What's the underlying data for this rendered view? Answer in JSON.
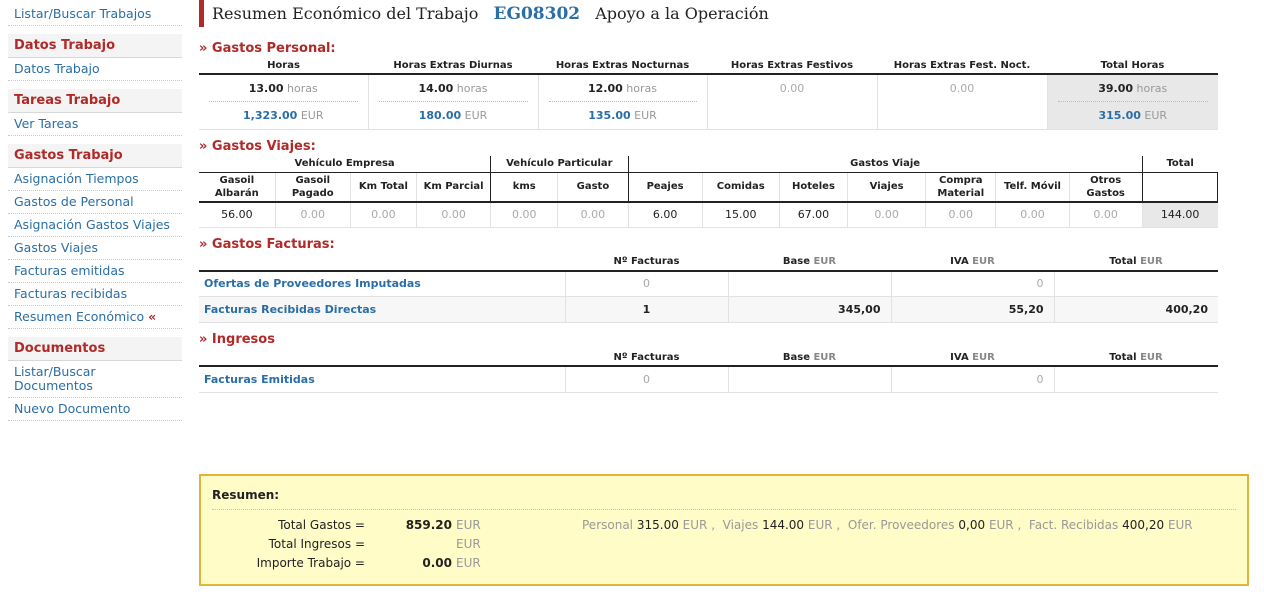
{
  "sidebar": {
    "top_link": "Listar/Buscar Trabajos",
    "sections": [
      {
        "heading": "Datos Trabajo",
        "links": [
          "Datos Trabajo"
        ]
      },
      {
        "heading": "Tareas Trabajo",
        "links": [
          "Ver Tareas"
        ]
      },
      {
        "heading": "Gastos Trabajo",
        "links": [
          "Asignación Tiempos",
          "Gastos de Personal",
          "Asignación Gastos Viajes",
          "Gastos Viajes",
          "Facturas emitidas",
          "Facturas recibidas",
          "Resumen Económico"
        ],
        "active_mark": "«"
      },
      {
        "heading": "Documentos",
        "links": [
          "Listar/Buscar Documentos",
          "Nuevo Documento"
        ]
      }
    ]
  },
  "header": {
    "title": "Resumen Económico del Trabajo",
    "code": "EG08302",
    "subtitle": "Apoyo a la Operación"
  },
  "personal": {
    "section_title": "» Gastos Personal:",
    "columns": [
      "Horas",
      "Horas Extras Diurnas",
      "Horas Extras Nocturnas",
      "Horas Extras Festivos",
      "Horas Extras Fest. Noct.",
      "Total Horas"
    ],
    "hours": [
      "13.00",
      "14.00",
      "12.00",
      "0.00",
      "0.00",
      "39.00"
    ],
    "hours_unit": "horas",
    "amounts": [
      "1,323.00",
      "180.00",
      "135.00",
      "",
      "",
      "315.00"
    ],
    "amount_unit": "EUR"
  },
  "viajes": {
    "section_title": "» Gastos Viajes:",
    "groups": [
      "Vehículo Empresa",
      "Vehículo Particular",
      "Gastos Viaje",
      "Total"
    ],
    "columns": [
      "Gasoil Albarán",
      "Gasoil Pagado",
      "Km Total",
      "Km Parcial",
      "kms",
      "Gasto",
      "Peajes",
      "Comidas",
      "Hoteles",
      "Viajes",
      "Compra Material",
      "Telf. Móvil",
      "Otros Gastos"
    ],
    "values": [
      "56.00",
      "0.00",
      "0.00",
      "0.00",
      "0.00",
      "0.00",
      "6.00",
      "15.00",
      "67.00",
      "0.00",
      "0.00",
      "0.00",
      "0.00"
    ],
    "total": "144.00"
  },
  "facturas": {
    "section_title": "» Gastos Facturas:",
    "columns": [
      "Nº Facturas",
      "Base",
      "IVA",
      "Total"
    ],
    "unit": "EUR",
    "rows": [
      {
        "name": "Ofertas de Proveedores Imputadas",
        "n": "0",
        "base": "",
        "iva": "0",
        "total": ""
      },
      {
        "name": "Facturas Recibidas Directas",
        "n": "1",
        "base": "345,00",
        "iva": "55,20",
        "total": "400,20"
      }
    ]
  },
  "ingresos": {
    "section_title": "» Ingresos",
    "columns": [
      "Nº Facturas",
      "Base",
      "IVA",
      "Total"
    ],
    "unit": "EUR",
    "rows": [
      {
        "name": "Facturas Emitidas",
        "n": "0",
        "base": "",
        "iva": "0",
        "total": ""
      }
    ]
  },
  "resumen": {
    "heading": "Resumen:",
    "unit": "EUR",
    "total_gastos_label": "Total Gastos =",
    "total_gastos": "859.20",
    "total_ingresos_label": "Total Ingresos =",
    "total_ingresos": "",
    "importe_label": "Importe Trabajo =",
    "importe": "0.00",
    "breakdown": {
      "personal_label": "Personal",
      "personal": "315.00",
      "viajes_label": "Viajes",
      "viajes": "144.00",
      "ofer_label": "Ofer. Proveedores",
      "ofer": "0,00",
      "fact_label": "Fact. Recibidas",
      "fact": "400,20"
    }
  }
}
